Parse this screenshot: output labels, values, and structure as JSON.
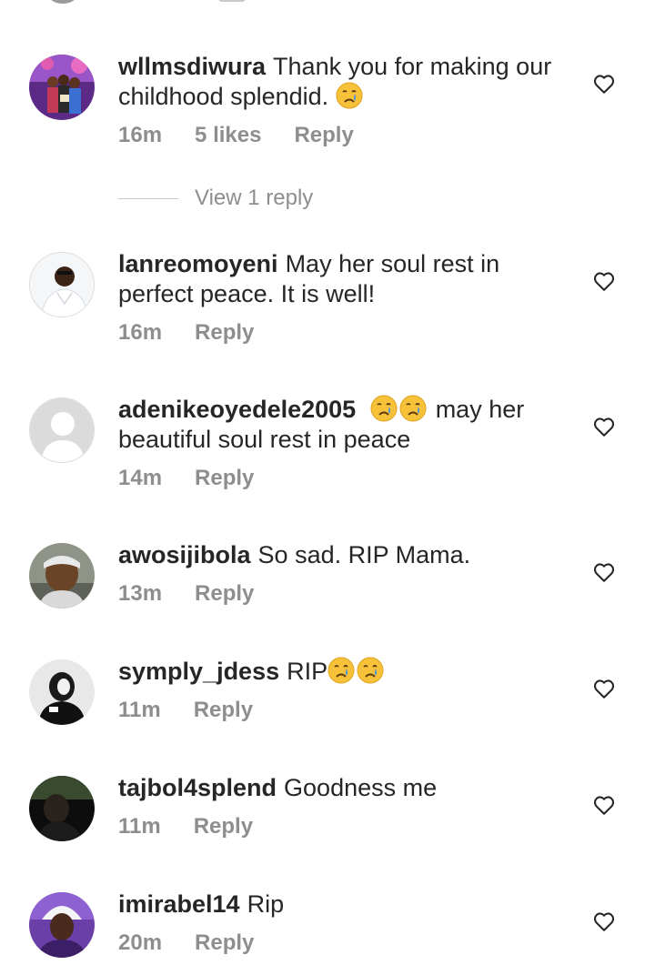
{
  "comments": [
    {
      "username": "wllmsdiwura",
      "text": "Thank you for making our childhood splendid.",
      "emoji_after": 1,
      "emoji_before": 0,
      "time": "16m",
      "likes": "5 likes",
      "reply": "Reply",
      "view_replies": "View 1 reply"
    },
    {
      "username": "lanreomoyeni",
      "text": "May her soul rest in perfect peace. It is well!",
      "time": "16m",
      "reply": "Reply"
    },
    {
      "username": "adenikeoyedele2005",
      "text": "may her beautiful soul rest in peace",
      "emoji_before": 2,
      "time": "14m",
      "reply": "Reply"
    },
    {
      "username": "awosijibola",
      "text": "So sad. RIP Mama.",
      "time": "13m",
      "reply": "Reply"
    },
    {
      "username": "symply_jdess",
      "text": "RIP",
      "emoji_after": 2,
      "time": "11m",
      "reply": "Reply"
    },
    {
      "username": "tajbol4splend",
      "text": "Goodness me",
      "time": "11m",
      "reply": "Reply"
    },
    {
      "username": "imirabel14",
      "text": "Rip",
      "time": "20m",
      "reply": "Reply"
    }
  ],
  "icons": {
    "like": "heart-outline-icon",
    "emoji": "crying-face-emoji"
  },
  "colors": {
    "text": "#262626",
    "secondary": "#8e8e8e",
    "emoji_face": "#f7c23a",
    "emoji_tear": "#4a90e2"
  }
}
